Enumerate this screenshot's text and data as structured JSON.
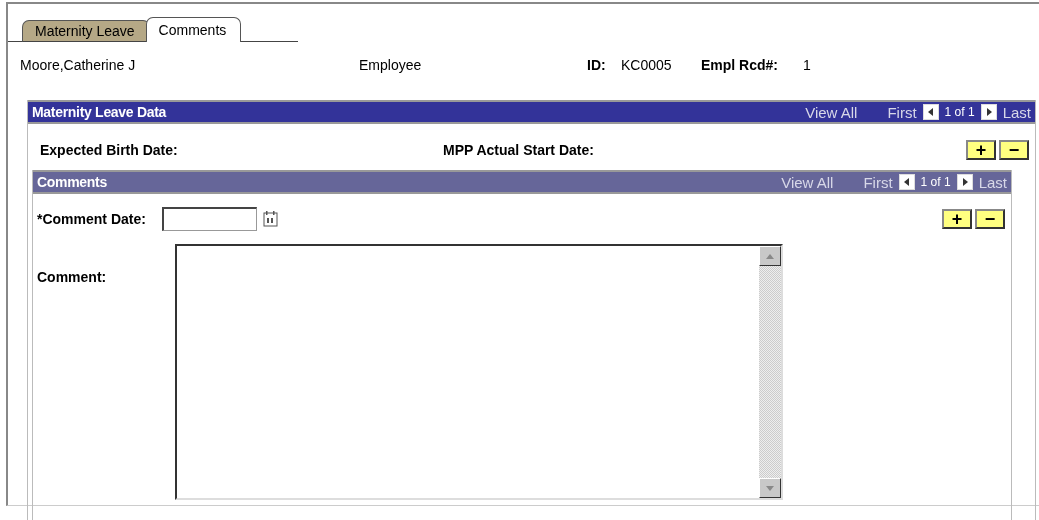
{
  "tabs": [
    {
      "label": "Maternity Leave",
      "selected": false
    },
    {
      "label": "Comments",
      "selected": true
    }
  ],
  "header": {
    "name": "Moore,Catherine J",
    "role": "Employee",
    "id_label": "ID:",
    "id_value": "KC0005",
    "rcd_label": "Empl Rcd#:",
    "rcd_value": "1"
  },
  "maternity_grid": {
    "title": "Maternity Leave Data",
    "view_all": "View All",
    "first": "First",
    "count": "1 of 1",
    "last": "Last",
    "fields": [
      {
        "label": "Expected Birth Date:"
      },
      {
        "label": "MPP Actual Start Date:"
      }
    ],
    "buttons": [
      "+",
      "−"
    ]
  },
  "comments_grid": {
    "title": "Comments",
    "view_all": "View All",
    "first": "First",
    "count": "1 of 1",
    "last": "Last",
    "buttons": [
      "+",
      "−"
    ],
    "comment_date": {
      "label": "*Comment Date:"
    },
    "comment": {
      "label": "Comment:"
    }
  }
}
